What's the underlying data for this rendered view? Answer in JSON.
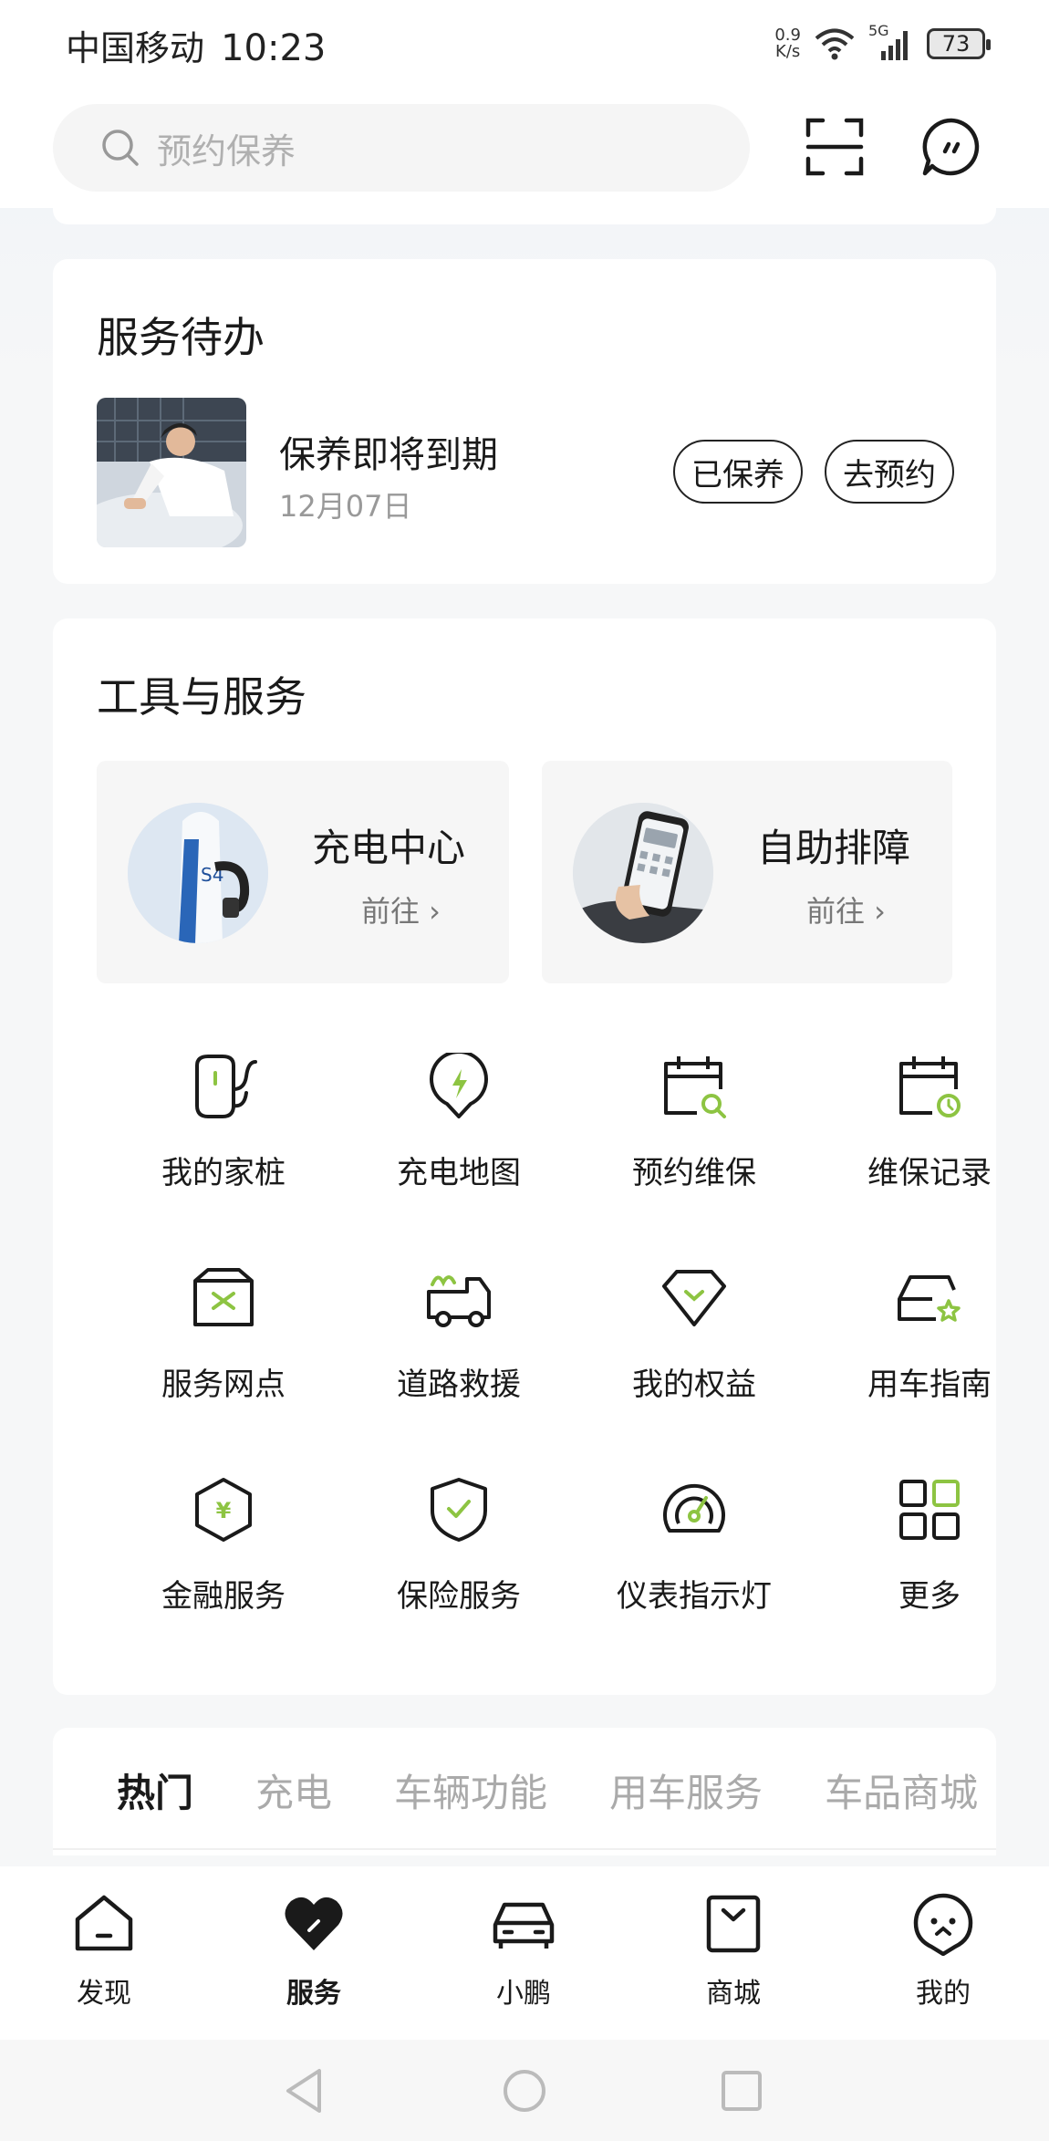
{
  "status_bar": {
    "carrier": "中国移动",
    "time": "10:23",
    "net_speed_value": "0.9",
    "net_speed_unit": "K/s",
    "signal_label": "5G",
    "battery": "73"
  },
  "header": {
    "search_placeholder": "预约保养",
    "scan_icon": "scan-icon",
    "message_icon": "message-icon"
  },
  "todo": {
    "title": "服务待办",
    "item_name": "保养即将到期",
    "item_date": "12月07日",
    "done_label": "已保养",
    "book_label": "去预约"
  },
  "tools": {
    "title": "工具与服务",
    "features": [
      {
        "title": "充电中心",
        "go": "前往 ›"
      },
      {
        "title": "自助排障",
        "go": "前往 ›"
      }
    ],
    "grid": [
      {
        "label": "我的家桩",
        "icon": "home-charger-icon"
      },
      {
        "label": "充电地图",
        "icon": "charge-map-icon"
      },
      {
        "label": "预约维保",
        "icon": "book-maintenance-icon"
      },
      {
        "label": "维保记录",
        "icon": "maintenance-record-icon"
      },
      {
        "label": "服务网点",
        "icon": "service-outlet-icon"
      },
      {
        "label": "道路救援",
        "icon": "road-rescue-icon"
      },
      {
        "label": "我的权益",
        "icon": "my-benefits-icon"
      },
      {
        "label": "用车指南",
        "icon": "car-guide-icon"
      },
      {
        "label": "金融服务",
        "icon": "finance-icon"
      },
      {
        "label": "保险服务",
        "icon": "insurance-icon"
      },
      {
        "label": "仪表指示灯",
        "icon": "dashboard-lights-icon"
      },
      {
        "label": "更多",
        "icon": "more-grid-icon"
      }
    ]
  },
  "content_tabs": [
    "热门",
    "充电",
    "车辆功能",
    "用车服务",
    "车品商城"
  ],
  "bottom_nav": [
    {
      "label": "发现",
      "icon": "discover-icon"
    },
    {
      "label": "服务",
      "icon": "service-heart-icon"
    },
    {
      "label": "小鹏",
      "icon": "car-icon"
    },
    {
      "label": "商城",
      "icon": "mall-icon"
    },
    {
      "label": "我的",
      "icon": "profile-icon"
    }
  ],
  "colors": {
    "accent_green": "#8dc442",
    "text": "#1a1a1a",
    "muted": "#999999"
  }
}
